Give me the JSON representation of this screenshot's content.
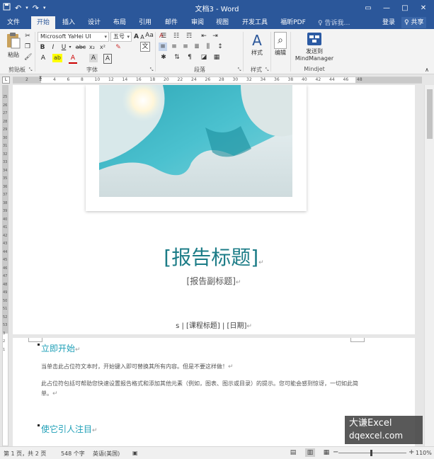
{
  "titlebar": {
    "title": "文档3 - Word",
    "qat_icons": [
      "save-icon",
      "undo-icon",
      "redo-icon"
    ],
    "min": "—",
    "max": "□",
    "close": "✕",
    "ribbon_display": "▭"
  },
  "tabs": [
    {
      "label": "文件"
    },
    {
      "label": "开始"
    },
    {
      "label": "插入"
    },
    {
      "label": "设计"
    },
    {
      "label": "布局"
    },
    {
      "label": "引用"
    },
    {
      "label": "邮件"
    },
    {
      "label": "审阅"
    },
    {
      "label": "视图"
    },
    {
      "label": "开发工具"
    },
    {
      "label": "福昕PDF"
    }
  ],
  "active_tab": "开始",
  "tell_me": "♀ 告诉我…",
  "login": "登录",
  "share": "♀ 共享",
  "ribbon": {
    "paste": "粘贴",
    "font_name": "Microsoft YaHei UI",
    "font_size": "五号",
    "styles": "样式",
    "editing": "编辑",
    "send_to_line1": "发送到",
    "send_to_line2": "MindManager",
    "groups": {
      "clipboard": "剪贴板",
      "font": "字体",
      "paragraph": "段落",
      "styles": "样式",
      "mindjet": "Mindjet"
    },
    "font_buttons": [
      "B",
      "I",
      "U",
      "abc",
      "x₂",
      "x²"
    ],
    "wen": "文",
    "a_big": "A",
    "a_small": "A",
    "aa": "Aa",
    "clear_fmt": "A",
    "phon": "wén",
    "border_a": "A",
    "a_color": "A",
    "highlight": "ab",
    "shade_a": "A"
  },
  "ruler_h_ticks": [
    "2",
    "2",
    "4",
    "6",
    "8",
    "10",
    "12",
    "14",
    "16",
    "18",
    "20",
    "22",
    "24",
    "26",
    "28",
    "30",
    "32",
    "34",
    "36",
    "38",
    "40",
    "42",
    "44",
    "46",
    "48"
  ],
  "ruler_v_ticks": [
    "25",
    "26",
    "27",
    "28",
    "29",
    "30",
    "31",
    "32",
    "33",
    "34",
    "35",
    "36",
    "37",
    "38",
    "39",
    "40",
    "41",
    "42",
    "43",
    "44",
    "45",
    "46",
    "47",
    "48",
    "49",
    "50",
    "51",
    "52",
    "53",
    "3",
    "2",
    "1"
  ],
  "document": {
    "title": "[报告标题]",
    "subtitle": "[报告副标题]",
    "meta": "s | [课程标题] | [日期]",
    "heading1": "立即开始",
    "para1": "当单击此占位符文本时，开始键入即可替换其所有内容。但是不要这样做！",
    "para2": "此占位符包括可帮助您快速设置报告格式和添加其他元素（例如，图表、图示或目录）的提示。您可能会感到惊讶，一切如此简单。",
    "heading2": "使它引人注目"
  },
  "watermark": {
    "line1": "大谦Excel",
    "line2": "dqexcel.com"
  },
  "status": {
    "page": "第 1 页，共 2 页",
    "words": "548 个字",
    "lang": "英语(美国)",
    "zoom_minus": "−",
    "zoom_plus": "+",
    "zoom": "110%"
  }
}
